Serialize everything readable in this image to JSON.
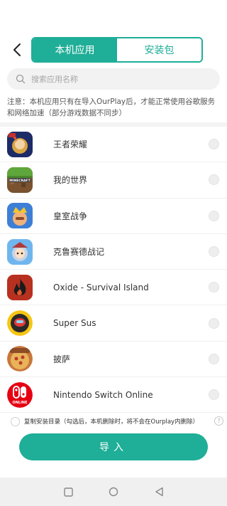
{
  "header": {
    "tabs": [
      {
        "label": "本机应用",
        "active": true
      },
      {
        "label": "安装包",
        "active": false
      }
    ]
  },
  "search": {
    "placeholder": "搜索应用名称"
  },
  "notice": "注意：本机应用只有在导入OurPlay后，才能正常使用谷歌服务和网络加速（部分游戏数据不同步）",
  "apps": [
    {
      "name": "王者荣耀",
      "icon": "honor-of-kings-icon"
    },
    {
      "name": "我的世界",
      "icon": "minecraft-icon"
    },
    {
      "name": "皇室战争",
      "icon": "clash-royale-icon"
    },
    {
      "name": "克鲁赛德战记",
      "icon": "crusaders-quest-icon"
    },
    {
      "name": "Oxide - Survival Island",
      "icon": "oxide-icon"
    },
    {
      "name": "Super Sus",
      "icon": "super-sus-icon"
    },
    {
      "name": "披萨",
      "icon": "pizza-icon"
    },
    {
      "name": "Nintendo Switch Online",
      "icon": "nintendo-switch-online-icon"
    }
  ],
  "copy_option": {
    "label": "复制安装目录（勾选后，本机删除时，将不会在Ourplay内删除）"
  },
  "import_button": "导入",
  "colors": {
    "accent": "#1fae97"
  }
}
